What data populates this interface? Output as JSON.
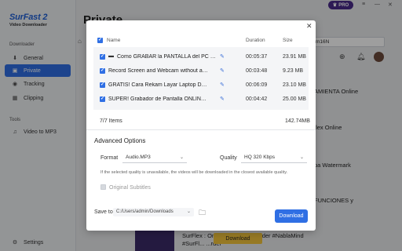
{
  "app": {
    "logo_main": "SurFast 2",
    "logo_sub": "Video Downloader",
    "pro_label": "PRO",
    "page_title": "Private",
    "sidebar": {
      "download_section": "Downloader",
      "items": [
        {
          "label": "General",
          "icon": "download-icon"
        },
        {
          "label": "Private",
          "icon": "lock-icon"
        },
        {
          "label": "Tracking",
          "icon": "tracking-icon"
        },
        {
          "label": "Clipping",
          "icon": "clip-icon"
        }
      ],
      "tools_section": "Tools",
      "tools": [
        {
          "label": "Video to MP3",
          "icon": "music-icon"
        }
      ],
      "settings_label": "Settings"
    },
    "background": {
      "search_value": "m16N",
      "items": [
        "AMIENTA Online",
        "flex Online",
        "pa Watermark",
        "FUNCIONES y"
      ],
      "bottom_line1": "SurFlex : Online Screen Recorder #NablaMind",
      "bottom_line2": "#SurFl... ...rder",
      "bottom_download": "Download"
    }
  },
  "dialog": {
    "header": {
      "name": "Name",
      "duration": "Duration",
      "size": "Size"
    },
    "rows": [
      {
        "title": "Como GRABAR  la PANTALLA del PC o MA...",
        "duration": "00:05:37",
        "size": "23.91 MB",
        "checked": true
      },
      {
        "title": "Record Screen and Webcam without any softw...",
        "duration": "00:03:48",
        "size": "9.23 MB",
        "checked": true
      },
      {
        "title": "GRATIS! Cara Rekam Layar Laptop Dengan Br...",
        "duration": "00:06:09",
        "size": "23.10 MB",
        "checked": true
      },
      {
        "title": "SUPER! Grabador de Pantalla ONLINE 2024 # ...",
        "duration": "00:04:42",
        "size": "25.00 MB",
        "checked": true
      }
    ],
    "items_count": "7/7 Items",
    "total_size": "142.74MB",
    "advanced_title": "Advanced Options",
    "format_label": "Format",
    "format_value": "Audio.MP3",
    "quality_label": "Quality",
    "quality_value": "HQ 320 Kbps",
    "note": "If the selected quality is unavailable, the videos will be downloaded in the closest available quality.",
    "original_subtitles": "Original Subtitles",
    "save_to_label": "Save to",
    "save_to_path": "C:/Users/admin/Downloads",
    "download_button": "Download",
    "accent": "#2f6fe4"
  }
}
